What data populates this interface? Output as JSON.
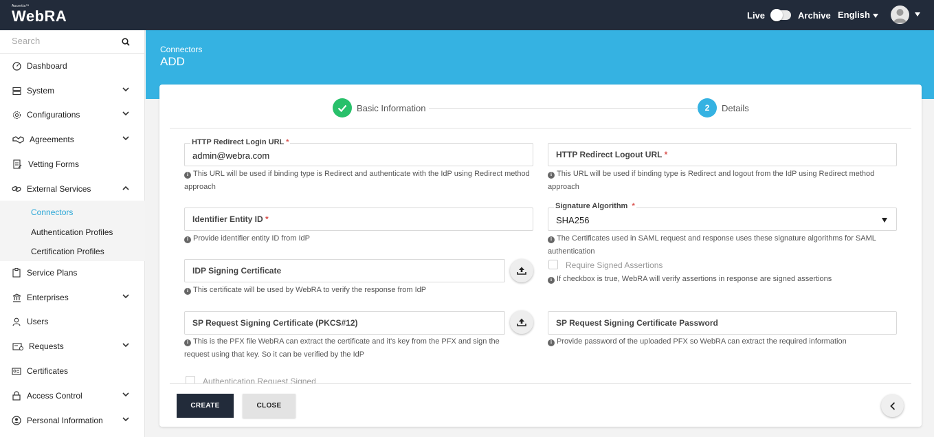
{
  "topbar": {
    "brand_sup": "Ascertia™",
    "brand_name": "WebRA",
    "live_label": "Live",
    "archive_label": "Archive",
    "language": "English"
  },
  "sidebar": {
    "search_placeholder": "Search",
    "items": [
      {
        "label": "Dashboard",
        "icon": "dashboard-icon"
      },
      {
        "label": "System",
        "icon": "server-icon"
      },
      {
        "label": "Configurations",
        "icon": "gear-icon"
      },
      {
        "label": "Agreements",
        "icon": "handshake-icon"
      },
      {
        "label": "Vetting Forms",
        "icon": "form-icon"
      },
      {
        "label": "External Services",
        "icon": "link-icon"
      },
      {
        "label": "Service Plans",
        "icon": "plan-icon"
      },
      {
        "label": "Enterprises",
        "icon": "bank-icon"
      },
      {
        "label": "Users",
        "icon": "user-icon"
      },
      {
        "label": "Requests",
        "icon": "request-icon"
      },
      {
        "label": "Certificates",
        "icon": "certificate-icon"
      },
      {
        "label": "Access Control",
        "icon": "lock-icon"
      },
      {
        "label": "Personal Information",
        "icon": "person-icon"
      }
    ],
    "external_services_sub": [
      {
        "label": "Connectors",
        "active": true
      },
      {
        "label": "Authentication Profiles",
        "active": false
      },
      {
        "label": "Certification Profiles",
        "active": false
      }
    ]
  },
  "header": {
    "breadcrumb": "Connectors",
    "title": "ADD"
  },
  "stepper": {
    "step1_label": "Basic Information",
    "step2_number": "2",
    "step2_label": "Details"
  },
  "form": {
    "login_url": {
      "label": "HTTP Redirect Login URL",
      "value": "admin@webra.com",
      "hint": "This URL will be used if binding type is Redirect and authenticate with the IdP using Redirect method approach"
    },
    "logout_url": {
      "label": "HTTP Redirect Logout URL",
      "value": "",
      "hint": "This URL will be used if binding type is Redirect and logout from the IdP using Redirect method approach"
    },
    "entity_id": {
      "label": "Identifier Entity ID",
      "value": "",
      "hint": "Provide identifier entity ID from IdP"
    },
    "signature_algorithm": {
      "label": "Signature Algorithm",
      "value": "SHA256",
      "hint": "The Certificates used in SAML request and response uses these signature algorithms for SAML authentication"
    },
    "idp_cert": {
      "label": "IDP Signing Certificate",
      "hint": "This certificate will be used by WebRA to verify the response from IdP"
    },
    "require_signed": {
      "label": "Require Signed Assertions",
      "checked": false,
      "hint": "If checkbox is true, WebRA will verify assertions in response are signed assertions"
    },
    "sp_cert": {
      "label": "SP Request Signing Certificate (PKCS#12)",
      "hint": "This is the PFX file WebRA can extract the certificate and it's key from the PFX and sign the request using that key. So it can be verified by the IdP"
    },
    "sp_password": {
      "label": "SP Request Signing Certificate Password",
      "hint": "Provide password of the uploaded PFX so WebRA can extract the required information"
    },
    "auth_request_signed": {
      "label": "Authentication Request Signed",
      "checked": false
    },
    "required_mark": "*"
  },
  "actions": {
    "create": "CREATE",
    "close": "CLOSE"
  },
  "colors": {
    "topbar": "#222b3a",
    "accent": "#35b2e2",
    "success": "#28c06a",
    "required": "#d9534f"
  }
}
